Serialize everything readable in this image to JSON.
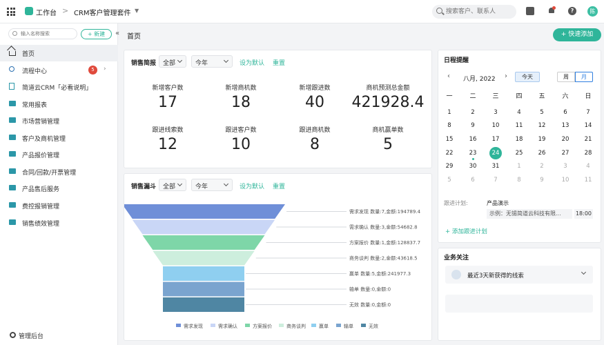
{
  "topbar": {
    "workspace": "工作台",
    "separator": ">",
    "app_name": "CRM客户管理套件",
    "search_placeholder": "搜索客户、联系人",
    "avatar_text": "陈"
  },
  "sidebar": {
    "search_placeholder": "输入名称搜索",
    "new_button": "+ 新建",
    "collapse": "«",
    "items": [
      {
        "label": "首页",
        "icon": "home-icon",
        "active": true
      },
      {
        "label": "流程中心",
        "icon": "flow-icon",
        "badge": "5",
        "expandable": true
      },
      {
        "label": "简道云CRM「必看说明」",
        "icon": "doc-icon"
      },
      {
        "label": "常用报表",
        "icon": "folder-icon"
      },
      {
        "label": "市场营销管理",
        "icon": "folder-icon"
      },
      {
        "label": "客户及商机管理",
        "icon": "folder-icon"
      },
      {
        "label": "产品报价管理",
        "icon": "folder-icon"
      },
      {
        "label": "合同/回款/开票管理",
        "icon": "folder-icon"
      },
      {
        "label": "产品售后服务",
        "icon": "folder-icon"
      },
      {
        "label": "费控报销管理",
        "icon": "folder-icon"
      },
      {
        "label": "销售绩效管理",
        "icon": "folder-icon"
      }
    ],
    "admin": "管理后台"
  },
  "main": {
    "title": "首页",
    "quick_add": "+ 快速添加"
  },
  "sales_brief": {
    "title": "销售简报",
    "scope": "全部",
    "period": "今年",
    "set_default": "设为默认",
    "reset": "重置",
    "stats": [
      {
        "label": "新增客户数",
        "value": "17"
      },
      {
        "label": "新增商机数",
        "value": "18"
      },
      {
        "label": "新增跟进数",
        "value": "40"
      },
      {
        "label": "商机预测总金额",
        "value": "421928.4"
      },
      {
        "label": "跟进线索数",
        "value": "12"
      },
      {
        "label": "跟进客户数",
        "value": "10"
      },
      {
        "label": "跟进商机数",
        "value": "8"
      },
      {
        "label": "商机赢单数",
        "value": "5"
      }
    ]
  },
  "sales_funnel": {
    "title": "销售漏斗",
    "scope": "全部",
    "period": "今年",
    "set_default": "设为默认",
    "reset": "重置"
  },
  "chart_data": {
    "type": "funnel",
    "stages": [
      {
        "name": "需求发现",
        "count": 7,
        "amount": 194789.4,
        "label": "需求发现 数量:7,金额:194789.4",
        "color": "#6f8fd8"
      },
      {
        "name": "需求确认",
        "count": 3,
        "amount": 54682.8,
        "label": "需求确认 数量:3,金额:54682.8",
        "color": "#c9d6f6"
      },
      {
        "name": "方案报价",
        "count": 1,
        "amount": 128837.7,
        "label": "方案报价 数量:1,金额:128837.7",
        "color": "#7ed6a8"
      },
      {
        "name": "商务谈判",
        "count": 2,
        "amount": 43618.5,
        "label": "商务谈判 数量:2,金额:43618.5",
        "color": "#cdeedd"
      },
      {
        "name": "赢单",
        "count": 5,
        "amount": 241977.3,
        "label": "赢单 数量:5,金额:241977.3",
        "color": "#8fcff0"
      },
      {
        "name": "输单",
        "count": 0,
        "amount": 0,
        "label": "输单 数量:0,金额:0",
        "color": "#7aa4cf"
      },
      {
        "name": "无效",
        "count": 0,
        "amount": 0,
        "label": "无效 数量:0,金额:0",
        "color": "#4f86a3"
      }
    ],
    "legend": [
      "需求发现",
      "需求确认",
      "方案报价",
      "商务谈判",
      "赢单",
      "输单",
      "无效"
    ],
    "legend_position": "bottom"
  },
  "calendar": {
    "title": "日程提醒",
    "prev": "‹",
    "next": "›",
    "month": "八月, 2022",
    "today_btn": "今天",
    "week_btn": "周",
    "month_btn": "月",
    "weekdays": [
      "一",
      "二",
      "三",
      "四",
      "五",
      "六",
      "日"
    ],
    "weeks": [
      [
        "1",
        "2",
        "3",
        "4",
        "5",
        "6",
        "7"
      ],
      [
        "8",
        "9",
        "10",
        "11",
        "12",
        "13",
        "14"
      ],
      [
        "15",
        "16",
        "17",
        "18",
        "19",
        "20",
        "21"
      ],
      [
        "22",
        "23",
        "24",
        "25",
        "26",
        "27",
        "28"
      ],
      [
        "29",
        "30",
        "31",
        "1",
        "2",
        "3",
        "4"
      ],
      [
        "5",
        "6",
        "7",
        "8",
        "9",
        "10",
        "11"
      ]
    ],
    "today": "24",
    "plan_label": "跟进计划:",
    "plan_name": "产品演示",
    "plan_example": "示例：无锡简道云科技有限...",
    "plan_time": "18:00",
    "add_plan": "+ 添加跟进计划"
  },
  "business": {
    "title": "业务关注",
    "item": "最近3天新获得的线索"
  }
}
